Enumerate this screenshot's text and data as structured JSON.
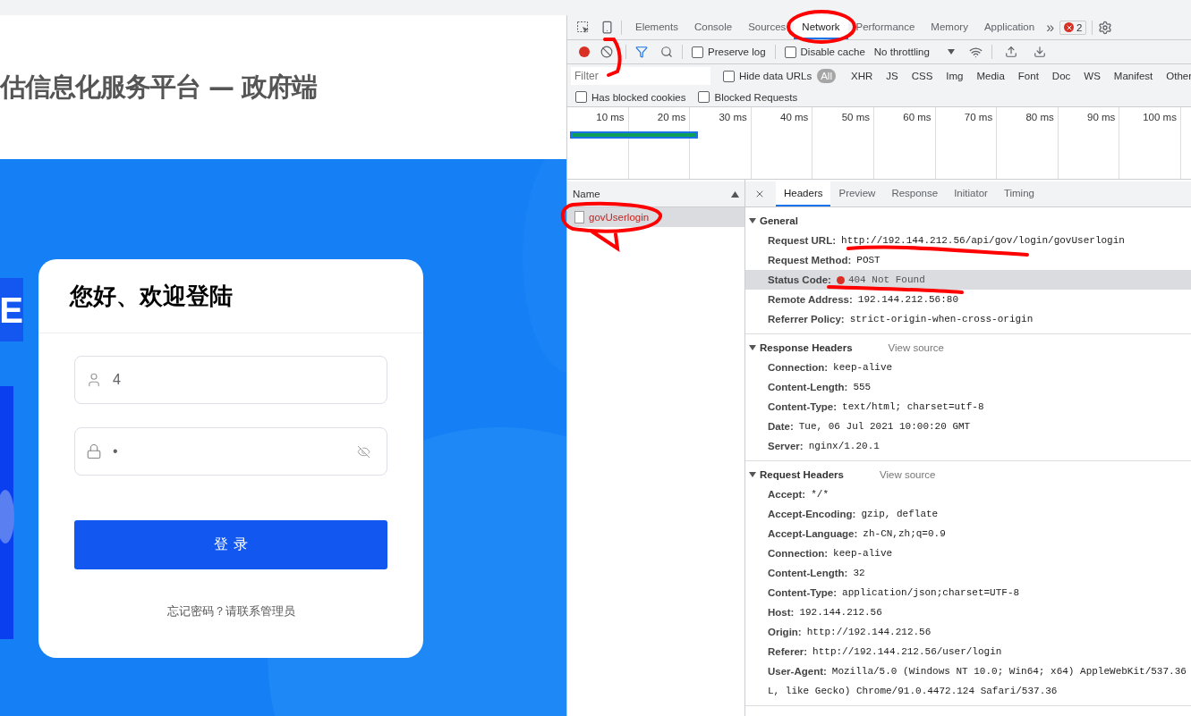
{
  "page": {
    "title": "估信息化服务平台 — 政府端",
    "logo_letter": "E",
    "card": {
      "heading": "您好、欢迎登陆",
      "username": {
        "value": "4"
      },
      "password": {
        "value": "•"
      },
      "login_button": "登 录",
      "forgot": "忘记密码？请联系管理员"
    }
  },
  "devtools": {
    "tabs": [
      {
        "label": "Elements",
        "selected": false
      },
      {
        "label": "Console",
        "selected": false
      },
      {
        "label": "Sources",
        "selected": false
      },
      {
        "label": "Network",
        "selected": true
      },
      {
        "label": "Performance",
        "selected": false
      },
      {
        "label": "Memory",
        "selected": false
      },
      {
        "label": "Application",
        "selected": false
      }
    ],
    "more": "»",
    "error_count": "2",
    "toolbar": {
      "recording": true,
      "preserve_log": {
        "label": "Preserve log",
        "checked": false
      },
      "disable_cache": {
        "label": "Disable cache",
        "checked": false
      },
      "throttling": "No throttling"
    },
    "filter": {
      "placeholder": "Filter",
      "hide_data_urls": {
        "label": "Hide data URLs",
        "checked": false
      },
      "types": [
        {
          "label": "All",
          "selected": true
        },
        {
          "label": "XHR",
          "selected": false
        },
        {
          "label": "JS",
          "selected": false
        },
        {
          "label": "CSS",
          "selected": false
        },
        {
          "label": "Img",
          "selected": false
        },
        {
          "label": "Media",
          "selected": false
        },
        {
          "label": "Font",
          "selected": false
        },
        {
          "label": "Doc",
          "selected": false
        },
        {
          "label": "WS",
          "selected": false
        },
        {
          "label": "Manifest",
          "selected": false
        },
        {
          "label": "Other",
          "selected": false
        }
      ]
    },
    "blocked": [
      {
        "label": "Has blocked cookies",
        "checked": false
      },
      {
        "label": "Blocked Requests",
        "checked": false
      }
    ],
    "timeline": {
      "ticks": [
        "10 ms",
        "20 ms",
        "30 ms",
        "40 ms",
        "50 ms",
        "60 ms",
        "70 ms",
        "80 ms",
        "90 ms",
        "100 ms"
      ]
    },
    "requests": {
      "column": "Name",
      "rows": [
        {
          "name": "govUserlogin",
          "selected": true
        }
      ]
    },
    "detail": {
      "tabs": [
        {
          "label": "Headers",
          "selected": true
        },
        {
          "label": "Preview",
          "selected": false
        },
        {
          "label": "Response",
          "selected": false
        },
        {
          "label": "Initiator",
          "selected": false
        },
        {
          "label": "Timing",
          "selected": false
        }
      ],
      "sections": [
        {
          "title": "General",
          "expanded": true,
          "rows": [
            {
              "key": "Request URL:",
              "value": "http://192.144.212.56/api/gov/login/govUserlogin",
              "kind": "plain",
              "highlighted": false
            },
            {
              "key": "Request Method:",
              "value": "POST",
              "kind": "plain",
              "highlighted": false
            },
            {
              "key": "Status Code:",
              "value": "404 Not Found",
              "kind": "status",
              "highlighted": true
            },
            {
              "key": "Remote Address:",
              "value": "192.144.212.56:80",
              "kind": "plain",
              "highlighted": false
            },
            {
              "key": "Referrer Policy:",
              "value": "strict-origin-when-cross-origin",
              "kind": "plain",
              "highlighted": false
            }
          ]
        },
        {
          "title": "Response Headers",
          "view_source": "View source",
          "expanded": true,
          "rows": [
            {
              "key": "Connection:",
              "value": "keep-alive",
              "kind": "plain",
              "highlighted": false
            },
            {
              "key": "Content-Length:",
              "value": "555",
              "kind": "plain",
              "highlighted": false
            },
            {
              "key": "Content-Type:",
              "value": "text/html; charset=utf-8",
              "kind": "plain",
              "highlighted": false
            },
            {
              "key": "Date:",
              "value": "Tue, 06 Jul 2021 10:00:20 GMT",
              "kind": "plain",
              "highlighted": false
            },
            {
              "key": "Server:",
              "value": "nginx/1.20.1",
              "kind": "plain",
              "highlighted": false
            }
          ]
        },
        {
          "title": "Request Headers",
          "view_source": "View source",
          "expanded": true,
          "rows": [
            {
              "key": "Accept:",
              "value": "*/*",
              "kind": "plain",
              "highlighted": false
            },
            {
              "key": "Accept-Encoding:",
              "value": "gzip, deflate",
              "kind": "plain",
              "highlighted": false
            },
            {
              "key": "Accept-Language:",
              "value": "zh-CN,zh;q=0.9",
              "kind": "plain",
              "highlighted": false
            },
            {
              "key": "Connection:",
              "value": "keep-alive",
              "kind": "plain",
              "highlighted": false
            },
            {
              "key": "Content-Length:",
              "value": "32",
              "kind": "plain",
              "highlighted": false
            },
            {
              "key": "Content-Type:",
              "value": "application/json;charset=UTF-8",
              "kind": "plain",
              "highlighted": false
            },
            {
              "key": "Host:",
              "value": "192.144.212.56",
              "kind": "plain",
              "highlighted": false
            },
            {
              "key": "Origin:",
              "value": "http://192.144.212.56",
              "kind": "plain",
              "highlighted": false
            },
            {
              "key": "Referer:",
              "value": "http://192.144.212.56/user/login",
              "kind": "plain",
              "highlighted": false
            },
            {
              "key": "User-Agent:",
              "value": "Mozilla/5.0 (Windows NT 10.0; Win64; x64) AppleWebKit/537.36",
              "continuation": "L, like Gecko) Chrome/91.0.4472.124 Safari/537.36",
              "kind": "plain",
              "highlighted": false
            }
          ]
        }
      ]
    }
  }
}
